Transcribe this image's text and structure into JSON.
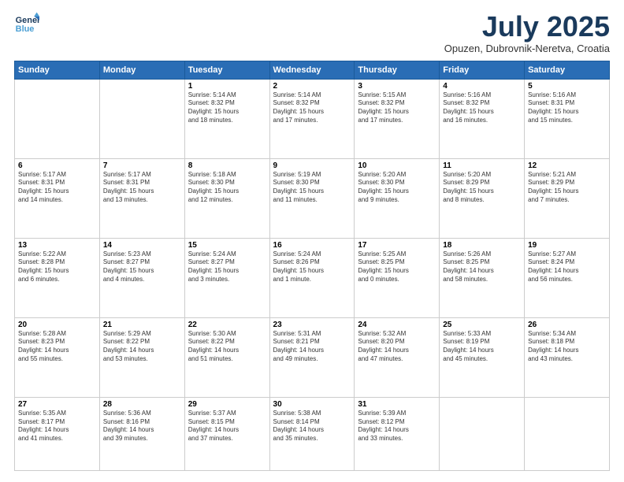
{
  "logo": {
    "line1": "General",
    "line2": "Blue"
  },
  "title": "July 2025",
  "subtitle": "Opuzen, Dubrovnik-Neretva, Croatia",
  "weekdays": [
    "Sunday",
    "Monday",
    "Tuesday",
    "Wednesday",
    "Thursday",
    "Friday",
    "Saturday"
  ],
  "weeks": [
    [
      {
        "day": "",
        "info": ""
      },
      {
        "day": "",
        "info": ""
      },
      {
        "day": "1",
        "info": "Sunrise: 5:14 AM\nSunset: 8:32 PM\nDaylight: 15 hours\nand 18 minutes."
      },
      {
        "day": "2",
        "info": "Sunrise: 5:14 AM\nSunset: 8:32 PM\nDaylight: 15 hours\nand 17 minutes."
      },
      {
        "day": "3",
        "info": "Sunrise: 5:15 AM\nSunset: 8:32 PM\nDaylight: 15 hours\nand 17 minutes."
      },
      {
        "day": "4",
        "info": "Sunrise: 5:16 AM\nSunset: 8:32 PM\nDaylight: 15 hours\nand 16 minutes."
      },
      {
        "day": "5",
        "info": "Sunrise: 5:16 AM\nSunset: 8:31 PM\nDaylight: 15 hours\nand 15 minutes."
      }
    ],
    [
      {
        "day": "6",
        "info": "Sunrise: 5:17 AM\nSunset: 8:31 PM\nDaylight: 15 hours\nand 14 minutes."
      },
      {
        "day": "7",
        "info": "Sunrise: 5:17 AM\nSunset: 8:31 PM\nDaylight: 15 hours\nand 13 minutes."
      },
      {
        "day": "8",
        "info": "Sunrise: 5:18 AM\nSunset: 8:30 PM\nDaylight: 15 hours\nand 12 minutes."
      },
      {
        "day": "9",
        "info": "Sunrise: 5:19 AM\nSunset: 8:30 PM\nDaylight: 15 hours\nand 11 minutes."
      },
      {
        "day": "10",
        "info": "Sunrise: 5:20 AM\nSunset: 8:30 PM\nDaylight: 15 hours\nand 9 minutes."
      },
      {
        "day": "11",
        "info": "Sunrise: 5:20 AM\nSunset: 8:29 PM\nDaylight: 15 hours\nand 8 minutes."
      },
      {
        "day": "12",
        "info": "Sunrise: 5:21 AM\nSunset: 8:29 PM\nDaylight: 15 hours\nand 7 minutes."
      }
    ],
    [
      {
        "day": "13",
        "info": "Sunrise: 5:22 AM\nSunset: 8:28 PM\nDaylight: 15 hours\nand 6 minutes."
      },
      {
        "day": "14",
        "info": "Sunrise: 5:23 AM\nSunset: 8:27 PM\nDaylight: 15 hours\nand 4 minutes."
      },
      {
        "day": "15",
        "info": "Sunrise: 5:24 AM\nSunset: 8:27 PM\nDaylight: 15 hours\nand 3 minutes."
      },
      {
        "day": "16",
        "info": "Sunrise: 5:24 AM\nSunset: 8:26 PM\nDaylight: 15 hours\nand 1 minute."
      },
      {
        "day": "17",
        "info": "Sunrise: 5:25 AM\nSunset: 8:25 PM\nDaylight: 15 hours\nand 0 minutes."
      },
      {
        "day": "18",
        "info": "Sunrise: 5:26 AM\nSunset: 8:25 PM\nDaylight: 14 hours\nand 58 minutes."
      },
      {
        "day": "19",
        "info": "Sunrise: 5:27 AM\nSunset: 8:24 PM\nDaylight: 14 hours\nand 56 minutes."
      }
    ],
    [
      {
        "day": "20",
        "info": "Sunrise: 5:28 AM\nSunset: 8:23 PM\nDaylight: 14 hours\nand 55 minutes."
      },
      {
        "day": "21",
        "info": "Sunrise: 5:29 AM\nSunset: 8:22 PM\nDaylight: 14 hours\nand 53 minutes."
      },
      {
        "day": "22",
        "info": "Sunrise: 5:30 AM\nSunset: 8:22 PM\nDaylight: 14 hours\nand 51 minutes."
      },
      {
        "day": "23",
        "info": "Sunrise: 5:31 AM\nSunset: 8:21 PM\nDaylight: 14 hours\nand 49 minutes."
      },
      {
        "day": "24",
        "info": "Sunrise: 5:32 AM\nSunset: 8:20 PM\nDaylight: 14 hours\nand 47 minutes."
      },
      {
        "day": "25",
        "info": "Sunrise: 5:33 AM\nSunset: 8:19 PM\nDaylight: 14 hours\nand 45 minutes."
      },
      {
        "day": "26",
        "info": "Sunrise: 5:34 AM\nSunset: 8:18 PM\nDaylight: 14 hours\nand 43 minutes."
      }
    ],
    [
      {
        "day": "27",
        "info": "Sunrise: 5:35 AM\nSunset: 8:17 PM\nDaylight: 14 hours\nand 41 minutes."
      },
      {
        "day": "28",
        "info": "Sunrise: 5:36 AM\nSunset: 8:16 PM\nDaylight: 14 hours\nand 39 minutes."
      },
      {
        "day": "29",
        "info": "Sunrise: 5:37 AM\nSunset: 8:15 PM\nDaylight: 14 hours\nand 37 minutes."
      },
      {
        "day": "30",
        "info": "Sunrise: 5:38 AM\nSunset: 8:14 PM\nDaylight: 14 hours\nand 35 minutes."
      },
      {
        "day": "31",
        "info": "Sunrise: 5:39 AM\nSunset: 8:12 PM\nDaylight: 14 hours\nand 33 minutes."
      },
      {
        "day": "",
        "info": ""
      },
      {
        "day": "",
        "info": ""
      }
    ]
  ]
}
